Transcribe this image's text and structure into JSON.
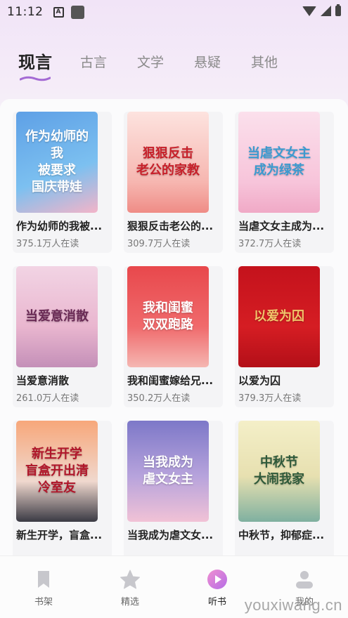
{
  "status_bar": {
    "time": "11:12",
    "a_icon": "A"
  },
  "tabs": [
    {
      "label": "现言",
      "active": true
    },
    {
      "label": "古言",
      "active": false
    },
    {
      "label": "文学",
      "active": false
    },
    {
      "label": "悬疑",
      "active": false
    },
    {
      "label": "其他",
      "active": false
    }
  ],
  "books": [
    {
      "title": "作为幼师的我被...",
      "readers": "375.1万人在读",
      "cover_text": "作为幼师的我\n被要求\n国庆带娃",
      "cover_bg": "linear-gradient(160deg,#5ea0e6,#7cc0f0 60%,#f3b4c8)"
    },
    {
      "title": "狠狠反击老公的...",
      "readers": "309.7万人在读",
      "cover_text": "狠狠反击\n老公的家教",
      "cover_bg": "linear-gradient(180deg,#fde3df,#f6b6b0 70%,#ef8c86)",
      "cover_color": "#c8202a"
    },
    {
      "title": "当虐文女主成为...",
      "readers": "372.7万人在读",
      "cover_text": "当虐文女主\n成为绿茶",
      "cover_bg": "linear-gradient(180deg,#fbe0ec,#f7c4da 70%,#f0a9c6)",
      "cover_color": "#3b9ad0"
    },
    {
      "title": "当爱意消散",
      "readers": "261.0万人在读",
      "cover_text": "当爱意消散",
      "cover_bg": "linear-gradient(180deg,#f2d4e4,#e9b6cf 60%,#c48fb8)",
      "cover_color": "#6a2a55"
    },
    {
      "title": "我和闺蜜嫁给兄...",
      "readers": "350.2万人在读",
      "cover_text": "我和闺蜜\n双双跑路",
      "cover_bg": "linear-gradient(180deg,#e8484c,#f06a6c 60%,#f5b7b2)"
    },
    {
      "title": "以爱为囚",
      "readers": "379.3万人在读",
      "cover_text": "以爱为囚",
      "cover_bg": "linear-gradient(180deg,#c4121c,#d51d23 60%,#b30f18)",
      "cover_color": "#f0c46a"
    },
    {
      "title": "新生开学，盲盒...",
      "readers": "",
      "cover_text": "新生开学\n盲盒开出清\n冷室友",
      "cover_bg": "linear-gradient(180deg,#f7a77a,#f0d8ce 60%,#3a3a44)",
      "cover_color": "#b0162a"
    },
    {
      "title": "当我成为虐文女...",
      "readers": "",
      "cover_text": "当我成为\n虐文女主",
      "cover_bg": "linear-gradient(180deg,#7d78c8,#b7a3dc 55%,#f1c2d6)"
    },
    {
      "title": "中秋节，抑郁症...",
      "readers": "",
      "cover_text": "中秋节\n大闹我家",
      "cover_bg": "linear-gradient(180deg,#f4efc8,#e7e0b0 55%,#7fb0a0)",
      "cover_color": "#2f5a3a"
    }
  ],
  "nav": [
    {
      "label": "书架",
      "icon": "bookmark-icon",
      "active": false
    },
    {
      "label": "精选",
      "icon": "star-icon",
      "active": false
    },
    {
      "label": "听书",
      "icon": "play-circle-icon",
      "active": true
    },
    {
      "label": "我的",
      "icon": "user-icon",
      "active": false
    }
  ],
  "watermark": "youxiwang.cn",
  "colors": {
    "accent": "#c06ce4",
    "tab_underline": "#a46ad4"
  }
}
